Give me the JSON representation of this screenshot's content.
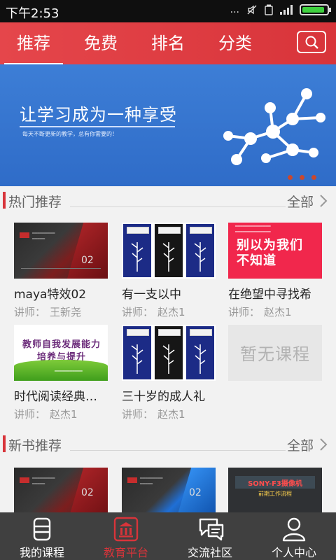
{
  "status_bar": {
    "time": "下午2:53",
    "dots": "...",
    "battery_level": 0.9
  },
  "top_nav": {
    "tabs": [
      {
        "label": "推荐",
        "active": true
      },
      {
        "label": "免费",
        "active": false
      },
      {
        "label": "排名",
        "active": false
      },
      {
        "label": "分类",
        "active": false
      }
    ],
    "search_icon": "search-icon",
    "bg_color": "#e5464b"
  },
  "banner": {
    "title": "让学习成为一种享受",
    "subtitle": "每天不断更新的教学，总有你需要的！",
    "page_count": 3
  },
  "hot_section": {
    "title": "热门推荐",
    "more": "全部",
    "courses": [
      {
        "title": "maya特效02",
        "teacher_label": "讲师：",
        "teacher": "王新尧",
        "thumb_num": "02"
      },
      {
        "title": "有一支以中",
        "teacher_label": "讲师：",
        "teacher": "赵杰1"
      },
      {
        "title": "在绝望中寻找希",
        "teacher_label": "讲师：",
        "teacher": "赵杰1",
        "thumb_text": "别以为我们不知道"
      },
      {
        "title": "时代阅读经典…",
        "teacher_label": "讲师：",
        "teacher": "赵杰1",
        "thumb_text": "教师自我发展能力培养与提升"
      },
      {
        "title": "三十岁的成人礼",
        "teacher_label": "讲师：",
        "teacher": "赵杰1"
      },
      {
        "placeholder": "暂无课程"
      }
    ]
  },
  "new_books_section": {
    "title": "新书推荐",
    "more": "全部",
    "books": [
      {
        "thumb_num": "02"
      },
      {
        "thumb_num": "02"
      },
      {
        "thumb_text": "SONY-F3摄像机",
        "thumb_sub": "前期工作流程"
      }
    ]
  },
  "bottom_nav": [
    {
      "label": "我的课程",
      "icon": "book-icon",
      "active": false
    },
    {
      "label": "教育平台",
      "icon": "school-icon",
      "active": true
    },
    {
      "label": "交流社区",
      "icon": "chat-icon",
      "active": false
    },
    {
      "label": "个人中心",
      "icon": "user-icon",
      "active": false
    }
  ],
  "colors": {
    "accent": "#d8343a",
    "banner": "#3d7ed6",
    "bottom_bar": "#404040"
  }
}
